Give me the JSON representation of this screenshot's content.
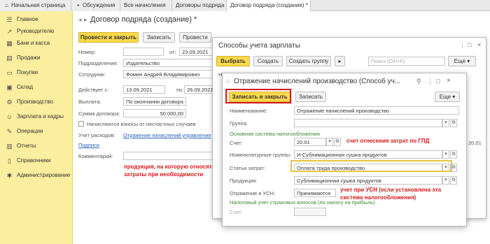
{
  "tabs": [
    {
      "icon": "home-icon",
      "label": "Начальная страница"
    },
    {
      "icon": "chat-icon",
      "label": "Обсуждения"
    },
    {
      "icon": "",
      "label": "Все начисления"
    },
    {
      "icon": "",
      "label": "Договоры подряда"
    },
    {
      "icon": "",
      "label": "Договор подряда (создание) *"
    }
  ],
  "sidebar": {
    "items": [
      {
        "icon": "menu-icon",
        "label": "Главное"
      },
      {
        "icon": "chart-icon",
        "label": "Руководителю"
      },
      {
        "icon": "bank-icon",
        "label": "Банк и касса"
      },
      {
        "icon": "sales-icon",
        "label": "Продажи"
      },
      {
        "icon": "cart-icon",
        "label": "Покупки"
      },
      {
        "icon": "warehouse-icon",
        "label": "Склад"
      },
      {
        "icon": "factory-icon",
        "label": "Производство"
      },
      {
        "icon": "people-icon",
        "label": "Зарплата и кадры"
      },
      {
        "icon": "operations-icon",
        "label": "Операции"
      },
      {
        "icon": "reports-icon",
        "label": "Отчеты"
      },
      {
        "icon": "book-icon",
        "label": "Справочники"
      },
      {
        "icon": "gear-icon",
        "label": "Администрирование"
      }
    ]
  },
  "doc": {
    "title": "Договор подряда (создание) *",
    "post_close": "Провести и закрыть",
    "save": "Записать",
    "post": "Провести",
    "number_label": "Номер:",
    "number_value": "",
    "from_label": "от:",
    "from_value": "23.09.2021",
    "dept_label": "Подразделение:",
    "dept_value": "Издательство",
    "employee_label": "Сотрудник:",
    "employee_value": "Фомин Андрей Владимирович",
    "valid_label": "Действует с:",
    "valid_from": "13.09.2021",
    "to_label": "по:",
    "valid_to": "26.09.2021",
    "payment_label": "Выплата:",
    "payment_value": "По окончании договора",
    "sum_label": "Сумма договора:",
    "sum_value": "50 000,00",
    "accident_label": "Начисляются взносы от несчастных случаев",
    "expense_label": "Учет расходов:",
    "expense_link": "Отражение начислений управление",
    "signatures_link": "Подписи",
    "comment_label": "Комментарий:"
  },
  "note1": {
    "line1": "продукция, на которую относятся",
    "line2": "затраты при необходимости"
  },
  "win1": {
    "title": "Способы учета зарплаты",
    "select": "Выбрать",
    "create": "Создать",
    "create_group": "Создать группу",
    "search_placeholder": "Поиск (Ctrl+F)",
    "more": "Еще",
    "col_n": "Н",
    "row_value": "20.01"
  },
  "win2": {
    "title": "Отражение начислений производство (Способ уч...",
    "save_close": "Записать и закрыть",
    "save": "Записать",
    "more": "Еще",
    "name_label": "Наименование:",
    "name_value": "Отражение начислений производство",
    "group_label": "Группа:",
    "group_value": "",
    "tax_system_heading": "Основная система налогообложения",
    "account_label": "Счет:",
    "account_value": "20.01",
    "nomenclature_label": "Номенклатурные группы:",
    "nomenclature_value": "И-Сублимационная сушка продуктов",
    "cost_label": "Статьи затрат:",
    "cost_value": "Оплата труда производство",
    "product_label": "Продукция:",
    "product_value": "Сублимационная сушка продуктов",
    "usn_label": "Отражение в УСН:",
    "usn_value": "Принимаются",
    "insurance_heading": "Налоговый учет страховых взносов (по налогу на прибыль)",
    "insurance_account_label": "Счет:"
  },
  "note2": "счет отнесения затрат по ГПД",
  "note3": {
    "line1": "учет при УСН (если установлена эта",
    "line2": "система налогообложения)"
  },
  "colors": {
    "accent_yellow": "#fbd94a",
    "sidebar": "#fbee9e",
    "highlight_red": "#d21a1a",
    "link": "#2b63b8",
    "green": "#3a8a2e"
  }
}
